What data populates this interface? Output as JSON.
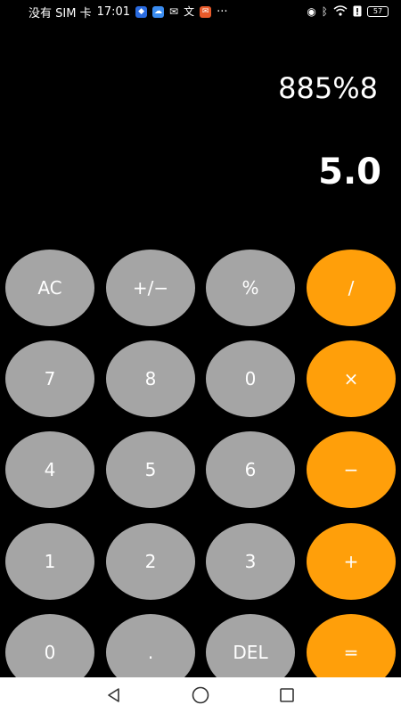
{
  "status_bar": {
    "carrier": "没有 SIM 卡",
    "time": "17:01",
    "more": "···",
    "battery": "57"
  },
  "display": {
    "expression": "885%8",
    "result": "5.0"
  },
  "keys": {
    "ac": "AC",
    "sign": "+/−",
    "percent": "%",
    "divide": "/",
    "seven": "7",
    "eight": "8",
    "zero_top": "0",
    "multiply": "×",
    "four": "4",
    "five": "5",
    "six": "6",
    "minus": "−",
    "one": "1",
    "two": "2",
    "three": "3",
    "plus": "+",
    "zero": "0",
    "dot": ".",
    "del": "DEL",
    "equals": "="
  },
  "colors": {
    "background": "#000000",
    "key_gray": "#a5a5a5",
    "key_orange": "#ff9f0a"
  }
}
